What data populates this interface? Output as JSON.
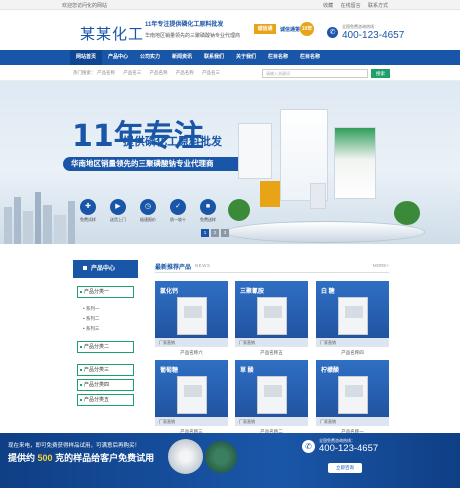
{
  "topbar": {
    "welcome": "欢迎您访问化的网站",
    "links": [
      "收藏",
      "在线留言",
      "联系方式"
    ]
  },
  "header": {
    "logo": "某某化工",
    "slogan_main": "11年专注提供磷化工原料批发",
    "slogan_sub": "华南地区销量领先的三聚磷酸钠专业代理商",
    "badge_label": "诚信通",
    "badge_text": "诚信通第",
    "badge_year": "10年",
    "phone_label": "全国免费咨询热线：",
    "phone_number": "400-123-4657"
  },
  "nav": {
    "items": [
      "网站首页",
      "产品中心",
      "公司实力",
      "新闻资讯",
      "联系我们",
      "关于我们",
      "栏目名称",
      "栏目名称"
    ]
  },
  "hotbar": {
    "label": "热门搜索：",
    "items": [
      "产品名称",
      "产品名三",
      "产品名称",
      "产品名称",
      "产品名三"
    ],
    "search_placeholder": "请输入关键词",
    "search_button": "搜索"
  },
  "banner": {
    "title": "11年专注",
    "subtitle": "提供磷化工原料批发",
    "ribbon": "华南地区销量领先的三聚磷酸钠专业代理商",
    "features": [
      "免费试样",
      "送货上门",
      "极速报价",
      "质一较十",
      "免费送样"
    ],
    "slides": [
      "1",
      "2",
      "3"
    ]
  },
  "sidebar": {
    "header": "产品中心",
    "categories": [
      {
        "label": "产品分类一",
        "subs": [
          "系列一",
          "系列二",
          "系列三"
        ]
      },
      {
        "label": "产品分类二",
        "subs": []
      },
      {
        "label": "产品分类三",
        "subs": []
      },
      {
        "label": "产品分类四",
        "subs": []
      },
      {
        "label": "产品分类五",
        "subs": []
      }
    ]
  },
  "products": {
    "title": "最新推荐产品",
    "title_en": "NEWS",
    "more": "MORE+",
    "items": [
      {
        "label": "氯化钙",
        "caption": "厂家直销",
        "name": "产品名称六"
      },
      {
        "label": "三聚氰胺",
        "caption": "厂家直销",
        "name": "产品名称五"
      },
      {
        "label": "白 糖",
        "caption": "厂家直销",
        "name": "产品名称四"
      },
      {
        "label": "葡萄糖",
        "caption": "厂家直销",
        "name": "产品名称三"
      },
      {
        "label": "草 酸",
        "caption": "厂家直销",
        "name": "产品名称二"
      },
      {
        "label": "柠檬酸",
        "caption": "厂家直销",
        "name": "产品名称一"
      }
    ]
  },
  "footer": {
    "line1": "现在来电，即可免费获得样品试用，可满意后再购买！",
    "line2_pre": "提供约",
    "line2_num": "500",
    "line2_post": "克的样品给客户免费试用",
    "phone_label": "全国免费咨询热线：",
    "phone_number": "400-123-4657",
    "button": "立即咨询"
  },
  "colors": {
    "primary": "#1a56a8",
    "accent_green": "#1ea06b",
    "gold": "#e8a317"
  }
}
